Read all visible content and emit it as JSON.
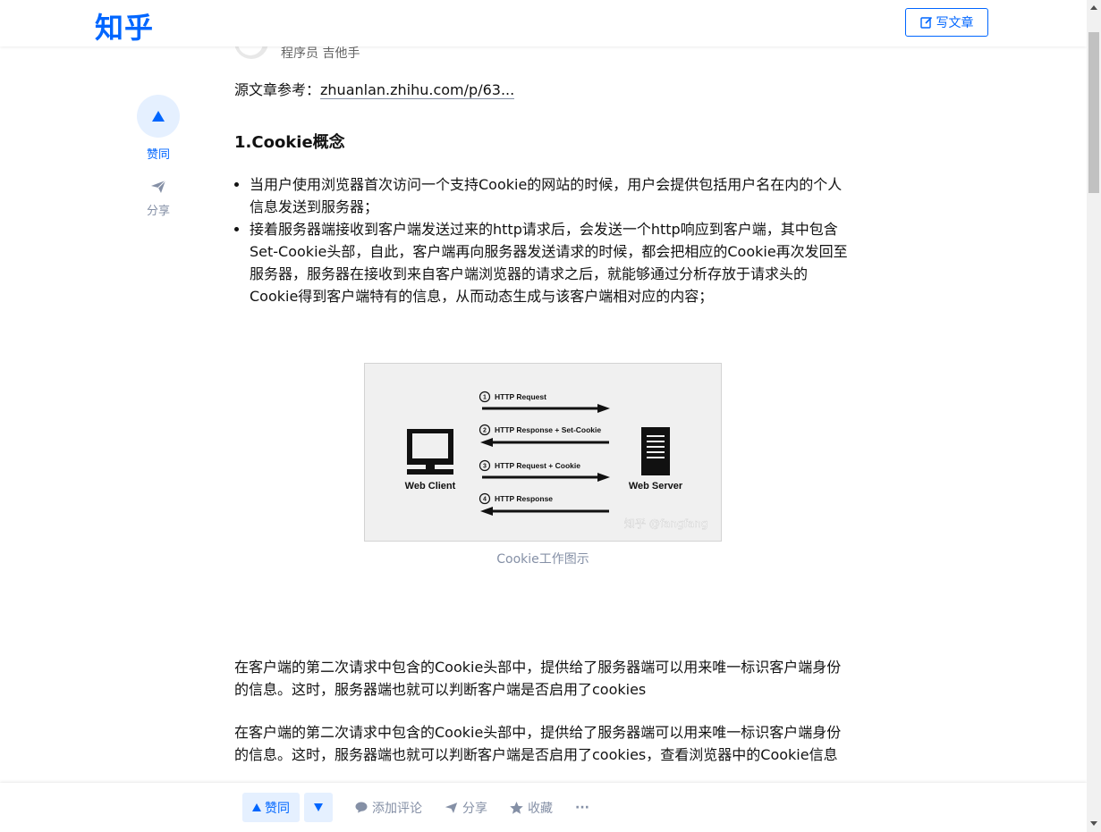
{
  "header": {
    "logo": "知乎",
    "write_label": "写文章"
  },
  "author": {
    "title": "程序员 吉他手"
  },
  "side": {
    "vote_label": "赞同",
    "share_label": "分享"
  },
  "article": {
    "ref_prefix": "源文章参考：",
    "ref_link": "zhuanlan.zhihu.com/p/63...",
    "heading": "1.Cookie概念",
    "bullets": [
      "当用户使用浏览器首次访问一个支持Cookie的网站的时候，用户会提供包括用户名在内的个人信息发送到服务器；",
      "接着服务器端接收到客户端发送过来的http请求后，会发送一个http响应到客户端，其中包含Set-Cookie头部，自此，客户端再向服务器发送请求的时候，都会把相应的Cookie再次发回至服务器，服务器在接收到来自客户端浏览器的请求之后，就能够通过分析存放于请求头的Cookie得到客户端特有的信息，从而动态生成与该客户端相对应的内容；"
    ],
    "figure": {
      "caption": "Cookie工作图示",
      "client_label": "Web Client",
      "server_label": "Web Server",
      "watermark": "知乎 @fangfang",
      "steps": [
        {
          "num": "1",
          "label": "HTTP Request"
        },
        {
          "num": "2",
          "label": "HTTP Response + Set-Cookie"
        },
        {
          "num": "3",
          "label": "HTTP Request + Cookie"
        },
        {
          "num": "4",
          "label": "HTTP Response"
        }
      ]
    },
    "para1": "在客户端的第二次请求中包含的Cookie头部中，提供给了服务器端可以用来唯一标识客户端身份的信息。这时，服务器端也就可以判断客户端是否启用了cookies",
    "para2": "在客户端的第二次请求中包含的Cookie头部中，提供给了服务器端可以用来唯一标识客户端身份的信息。这时，服务器端也就可以判断客户端是否启用了cookies，查看浏览器中的Cookie信息"
  },
  "bottom_bar": {
    "upvote": "赞同",
    "comment": "添加评论",
    "share": "分享",
    "collect": "收藏",
    "more": "···"
  },
  "colors": {
    "brand": "#0066ff",
    "muted": "#8590a6"
  }
}
